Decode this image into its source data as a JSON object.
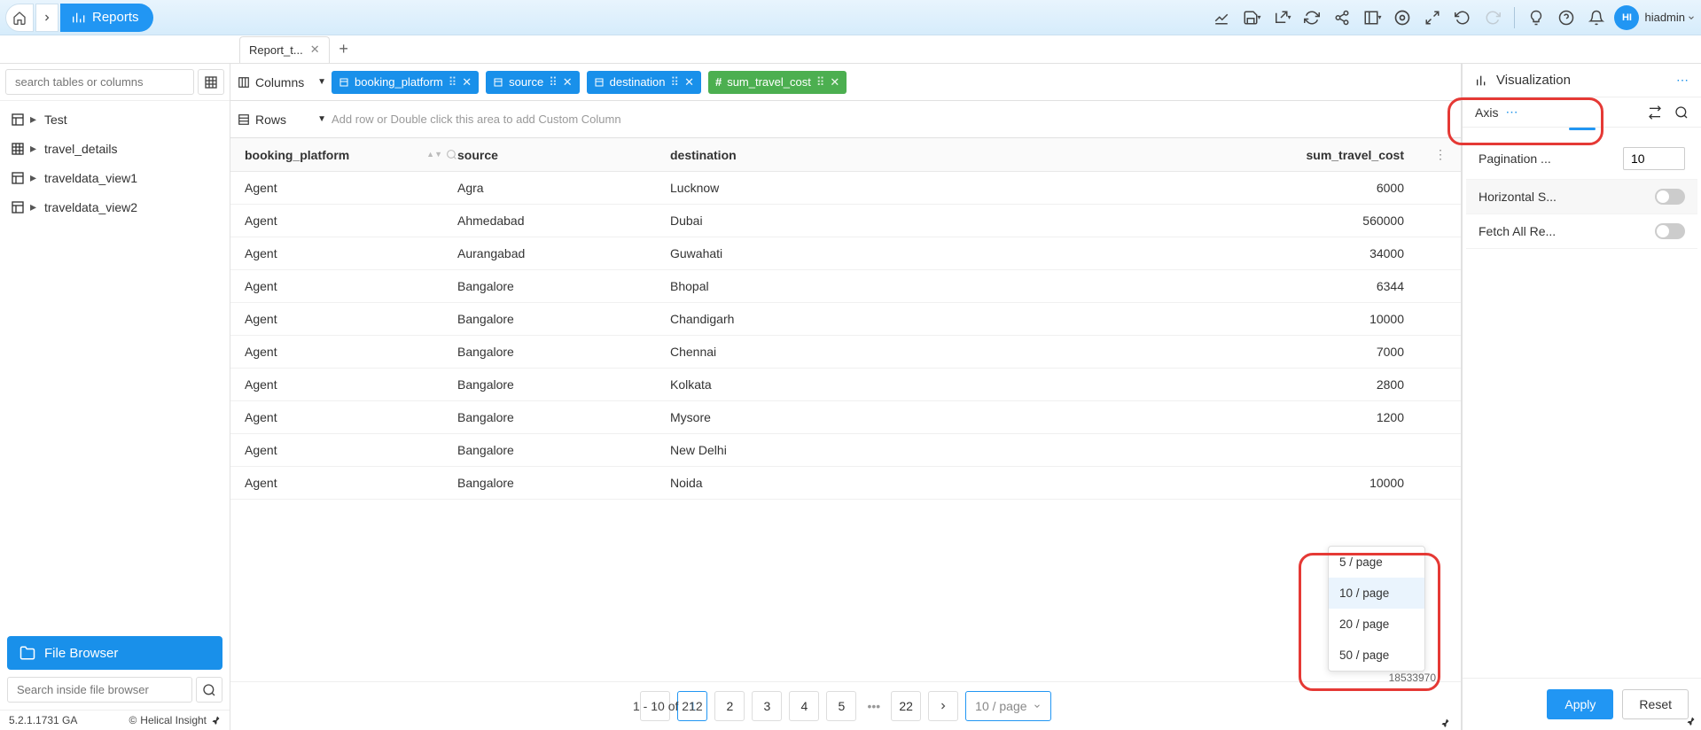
{
  "topbar": {
    "reports_label": "Reports",
    "user_initials": "HI",
    "user_label": "hiadmin"
  },
  "tabs": [
    {
      "label": "Report_t..."
    }
  ],
  "sidebar": {
    "search_placeholder": "search tables or columns",
    "tree": [
      {
        "icon": "cube",
        "label": "Test"
      },
      {
        "icon": "grid",
        "label": "travel_details"
      },
      {
        "icon": "cube",
        "label": "traveldata_view1"
      },
      {
        "icon": "cube",
        "label": "traveldata_view2"
      }
    ],
    "file_browser_label": "File Browser",
    "file_search_placeholder": "Search inside file browser",
    "version": "5.2.1.1731 GA",
    "copyright": "Helical Insight"
  },
  "columns_shelf": {
    "label": "Columns",
    "pills": [
      {
        "kind": "dim",
        "label": "booking_platform"
      },
      {
        "kind": "dim",
        "label": "source"
      },
      {
        "kind": "dim",
        "label": "destination"
      },
      {
        "kind": "meas",
        "label": "sum_travel_cost"
      }
    ]
  },
  "rows_shelf": {
    "label": "Rows",
    "placeholder": "Add row or Double click this area to add Custom Column"
  },
  "table": {
    "headers": [
      {
        "label": "booking_platform",
        "type": "text"
      },
      {
        "label": "source",
        "type": "text"
      },
      {
        "label": "destination",
        "type": "text"
      },
      {
        "label": "sum_travel_cost",
        "type": "num"
      }
    ],
    "rows": [
      [
        "Agent",
        "Agra",
        "Lucknow",
        "6000"
      ],
      [
        "Agent",
        "Ahmedabad",
        "Dubai",
        "560000"
      ],
      [
        "Agent",
        "Aurangabad",
        "Guwahati",
        "34000"
      ],
      [
        "Agent",
        "Bangalore",
        "Bhopal",
        "6344"
      ],
      [
        "Agent",
        "Bangalore",
        "Chandigarh",
        "10000"
      ],
      [
        "Agent",
        "Bangalore",
        "Chennai",
        "7000"
      ],
      [
        "Agent",
        "Bangalore",
        "Kolkata",
        "2800"
      ],
      [
        "Agent",
        "Bangalore",
        "Mysore",
        "1200"
      ],
      [
        "Agent",
        "Bangalore",
        "New Delhi",
        ""
      ],
      [
        "Agent",
        "Bangalore",
        "Noida",
        "10000"
      ]
    ],
    "footer_value_partial": "18533970"
  },
  "pager": {
    "info": "1 - 10 of 212",
    "pages": [
      "1",
      "2",
      "3",
      "4",
      "5"
    ],
    "last_page": "22",
    "active": "1",
    "size_label": "10 / page",
    "popup_options": [
      "5 / page",
      "10 / page",
      "20 / page",
      "50 / page"
    ],
    "popup_selected": "10 / page"
  },
  "right": {
    "title": "Visualization",
    "axis_label": "Axis",
    "pagination_label": "Pagination ...",
    "pagination_value": "10",
    "hscroll_label": "Horizontal S...",
    "fetchall_label": "Fetch All Re...",
    "apply_label": "Apply",
    "reset_label": "Reset"
  }
}
